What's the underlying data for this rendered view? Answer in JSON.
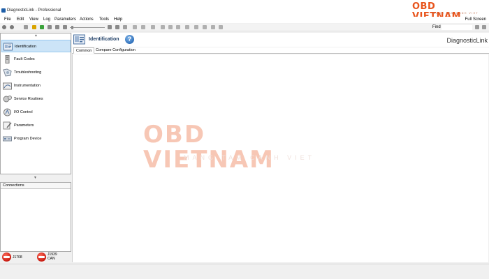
{
  "window": {
    "title": "DiagnosticLink - Professional"
  },
  "watermark": {
    "brand": "OBD VIETNAM",
    "tagline": "MANG TAM CANH VIET"
  },
  "menu": {
    "items": [
      "File",
      "Edit",
      "View",
      "Log",
      "Parameters",
      "Actions",
      "Tools",
      "Help"
    ],
    "fullscreen_label": "Full Screen"
  },
  "toolbar": {
    "find_label": "Find",
    "find_value": ""
  },
  "nav": {
    "items": [
      {
        "label": "Identification",
        "icon": "identification-icon",
        "active": true
      },
      {
        "label": "Fault Codes",
        "icon": "fault-codes-icon",
        "active": false
      },
      {
        "label": "Troubleshooting",
        "icon": "troubleshooting-icon",
        "active": false
      },
      {
        "label": "Instrumentation",
        "icon": "instrumentation-icon",
        "active": false
      },
      {
        "label": "Service Routines",
        "icon": "service-routines-icon",
        "active": false
      },
      {
        "label": "I/O Control",
        "icon": "io-control-icon",
        "active": false
      },
      {
        "label": "Parameters",
        "icon": "parameters-icon",
        "active": false
      },
      {
        "label": "Program Device",
        "icon": "program-device-icon",
        "active": false
      }
    ]
  },
  "connections": {
    "title": "Connections"
  },
  "status": {
    "indicators": [
      {
        "label": "J1708"
      },
      {
        "label_line1": "J1939",
        "label_line2": "CAN"
      }
    ]
  },
  "main": {
    "title": "Identification",
    "logo_text": "DiagnosticLink",
    "tabs": [
      {
        "label": "Common",
        "active": true
      },
      {
        "label": "Compare Configuration",
        "active": false
      }
    ]
  },
  "colors": {
    "accent": "#1e3e66",
    "nav_active_bg": "#cce4f7",
    "status_red": "#c81a10",
    "watermark_orange": "#e8541c"
  }
}
